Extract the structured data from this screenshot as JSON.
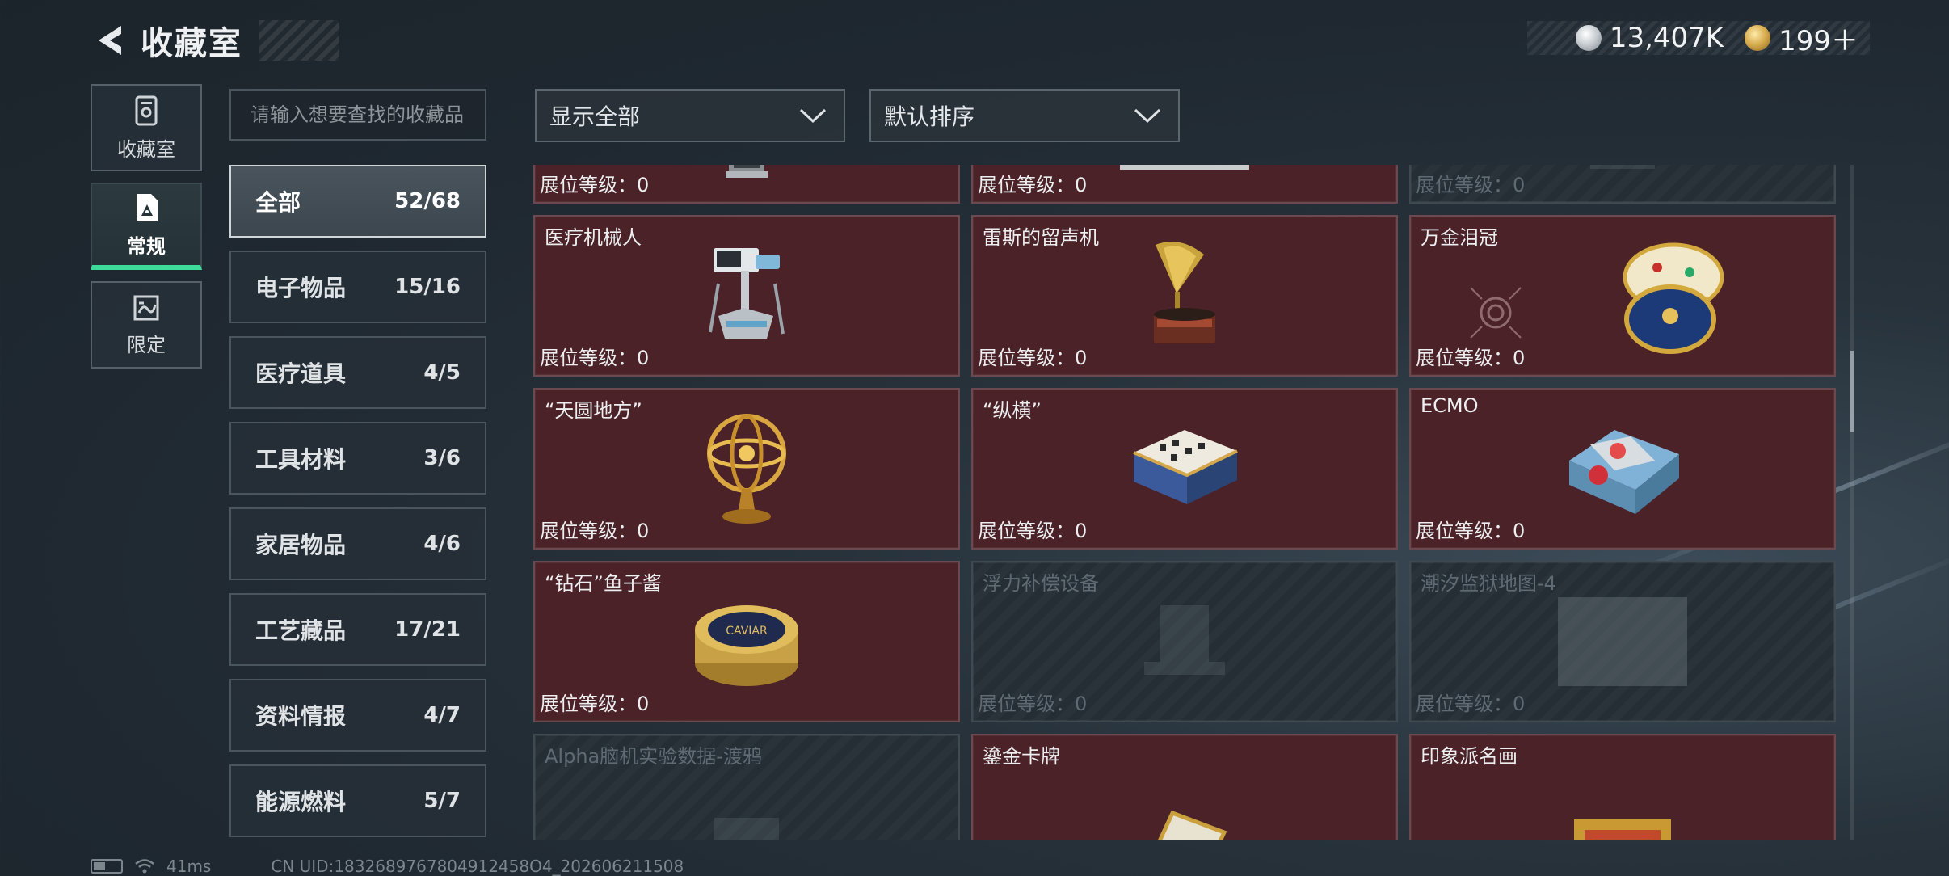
{
  "header": {
    "title": "收藏室",
    "back_icon": "back-arrow-icon"
  },
  "currency": [
    {
      "icon": "silver-coin-icon",
      "value": "13,407K"
    },
    {
      "icon": "gold-coin-icon",
      "value": "199＋"
    }
  ],
  "side_nav": [
    {
      "label": "收藏室",
      "icon": "collection-room-icon",
      "active": false
    },
    {
      "label": "常规",
      "icon": "regular-icon",
      "active": true
    },
    {
      "label": "限定",
      "icon": "limited-icon",
      "active": false
    }
  ],
  "search": {
    "placeholder": "请输入想要查找的收藏品"
  },
  "categories": [
    {
      "name": "全部",
      "count": "52/68",
      "active": true
    },
    {
      "name": "电子物品",
      "count": "15/16"
    },
    {
      "name": "医疗道具",
      "count": "4/5"
    },
    {
      "name": "工具材料",
      "count": "3/6"
    },
    {
      "name": "家居物品",
      "count": "4/6"
    },
    {
      "name": "工艺藏品",
      "count": "17/21"
    },
    {
      "name": "资料情报",
      "count": "4/7"
    },
    {
      "name": "能源燃料",
      "count": "5/7"
    }
  ],
  "filters": {
    "display": "显示全部",
    "sort": "默认排序"
  },
  "level_label": "展位等级：0",
  "cards": [
    {
      "name": "",
      "level": "展位等级：0",
      "locked": false,
      "icon": "tower-item-icon"
    },
    {
      "name": "",
      "level": "展位等级：0",
      "locked": false,
      "icon": "server-item-icon"
    },
    {
      "name": "",
      "level": "展位等级：0",
      "locked": true,
      "icon": "locked-item-icon"
    },
    {
      "name": "医疗机械人",
      "level": "展位等级：0",
      "locked": false,
      "icon": "medical-robot-icon"
    },
    {
      "name": "雷斯的留声机",
      "level": "展位等级：0",
      "locked": false,
      "icon": "gramophone-icon"
    },
    {
      "name": "万金泪冠",
      "level": "展位等级：0",
      "locked": false,
      "icon": "jeweled-egg-icon"
    },
    {
      "name": "“天圆地方”",
      "level": "展位等级：0",
      "locked": false,
      "icon": "armillary-sphere-icon"
    },
    {
      "name": "“纵横”",
      "level": "展位等级：0",
      "locked": false,
      "icon": "chess-box-icon"
    },
    {
      "name": "ECMO",
      "level": "展位等级：0",
      "locked": false,
      "icon": "ecmo-machine-icon"
    },
    {
      "name": "“钻石”鱼子酱",
      "level": "展位等级：0",
      "locked": false,
      "icon": "caviar-tin-icon"
    },
    {
      "name": "浮力补偿设备",
      "level": "展位等级：0",
      "locked": true,
      "icon": "buoyancy-device-icon"
    },
    {
      "name": "潮汐监狱地图-4",
      "level": "展位等级：0",
      "locked": true,
      "icon": "map-icon"
    },
    {
      "name": "Alpha脑机实验数据-渡鸦",
      "level": "",
      "locked": true,
      "icon": "data-drive-icon"
    },
    {
      "name": "鎏金卡牌",
      "level": "",
      "locked": false,
      "icon": "gilded-card-icon"
    },
    {
      "name": "印象派名画",
      "level": "",
      "locked": false,
      "icon": "painting-icon"
    }
  ],
  "status_bar": {
    "ping": "41ms",
    "uid": "CN UID:1832689767804912458O4_202606211508"
  }
}
